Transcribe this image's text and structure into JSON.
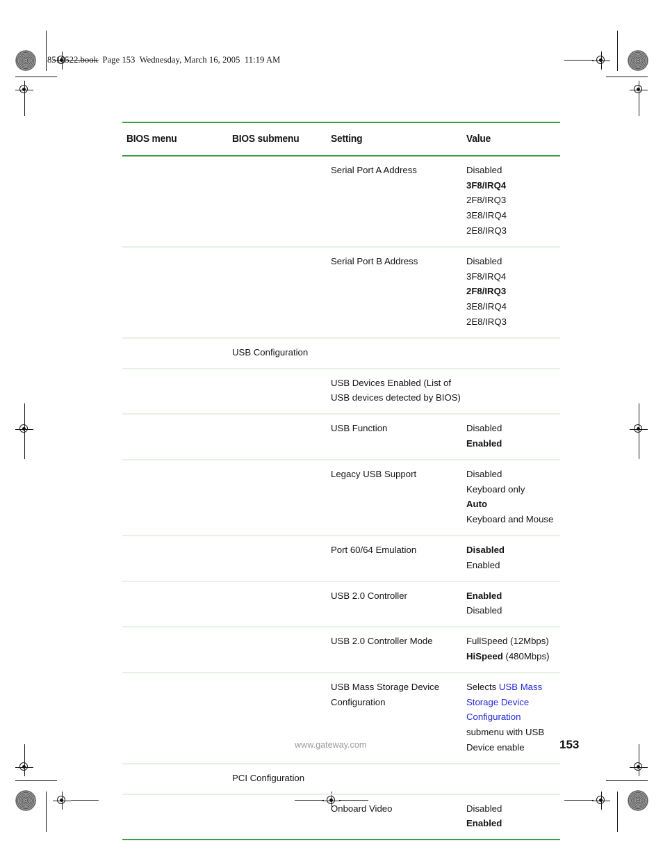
{
  "page": {
    "slug": "8510522.book  Page 153  Wednesday, March 16, 2005  11:19 AM",
    "footer_url": "www.gateway.com",
    "footer_page": "153",
    "rule_color": "#3d9b42",
    "separator_color": "#e4f1e4",
    "link_color": "#2327d8"
  },
  "table": {
    "headers": {
      "menu": "BIOS menu",
      "submenu": "BIOS submenu",
      "setting": "Setting",
      "value": "Value"
    },
    "rows": [
      {
        "menu": [],
        "submenu": [],
        "setting": [
          {
            "text": "Serial Port A Address",
            "bold": false
          }
        ],
        "value": [
          {
            "text": "Disabled",
            "bold": false
          },
          {
            "text": "3F8/IRQ4",
            "bold": true
          },
          {
            "text": "2F8/IRQ3",
            "bold": false
          },
          {
            "text": "3E8/IRQ4",
            "bold": false
          },
          {
            "text": "2E8/IRQ3",
            "bold": false
          }
        ]
      },
      {
        "menu": [],
        "submenu": [],
        "setting": [
          {
            "text": "Serial Port B Address",
            "bold": false
          }
        ],
        "value": [
          {
            "text": "Disabled",
            "bold": false
          },
          {
            "text": "3F8/IRQ4",
            "bold": false
          },
          {
            "text": "2F8/IRQ3",
            "bold": true
          },
          {
            "text": "3E8/IRQ4",
            "bold": false
          },
          {
            "text": "2E8/IRQ3",
            "bold": false
          }
        ]
      },
      {
        "menu": [],
        "submenu": [
          {
            "text": "USB Configuration",
            "bold": false
          }
        ],
        "setting": [],
        "value": []
      },
      {
        "menu": [],
        "submenu": [],
        "setting": [
          {
            "text": "USB Devices Enabled (List of USB devices detected by BIOS)",
            "bold": false
          }
        ],
        "value": []
      },
      {
        "menu": [],
        "submenu": [],
        "setting": [
          {
            "text": "USB Function",
            "bold": false
          }
        ],
        "value": [
          {
            "text": "Disabled",
            "bold": false
          },
          {
            "text": "Enabled",
            "bold": true
          }
        ]
      },
      {
        "menu": [],
        "submenu": [],
        "setting": [
          {
            "text": "Legacy USB Support",
            "bold": false
          }
        ],
        "value": [
          {
            "text": "Disabled",
            "bold": false
          },
          {
            "text": "Keyboard only",
            "bold": false
          },
          {
            "text": "Auto",
            "bold": true
          },
          {
            "text": "Keyboard and Mouse",
            "bold": false
          }
        ]
      },
      {
        "menu": [],
        "submenu": [],
        "setting": [
          {
            "text": "Port 60/64 Emulation",
            "bold": false
          }
        ],
        "value": [
          {
            "text": "Disabled",
            "bold": true
          },
          {
            "text": "Enabled",
            "bold": false
          }
        ]
      },
      {
        "menu": [],
        "submenu": [],
        "setting": [
          {
            "text": "USB 2.0 Controller",
            "bold": false
          }
        ],
        "value": [
          {
            "text": "Enabled",
            "bold": true
          },
          {
            "text": "Disabled",
            "bold": false
          }
        ]
      },
      {
        "menu": [],
        "submenu": [],
        "setting": [
          {
            "text": "USB 2.0 Controller Mode",
            "bold": false
          }
        ],
        "value": [
          {
            "parts": [
              {
                "text": "FullSpeed (12Mbps)",
                "bold": false
              }
            ]
          },
          {
            "parts": [
              {
                "text": "HiSpeed",
                "bold": true
              },
              {
                "text": " (480Mbps)",
                "bold": false
              }
            ]
          }
        ]
      },
      {
        "menu": [],
        "submenu": [],
        "setting": [
          {
            "text": "USB Mass Storage Device Configuration",
            "bold": false
          }
        ],
        "value": [
          {
            "parts": [
              {
                "text": "Selects ",
                "bold": false
              },
              {
                "text": "USB Mass Storage Device Configuration",
                "bold": false,
                "link": true
              },
              {
                "text": " submenu with USB Device enable",
                "bold": false
              }
            ]
          }
        ]
      },
      {
        "menu": [],
        "submenu": [
          {
            "text": "PCI Configuration",
            "bold": false
          }
        ],
        "setting": [],
        "value": []
      },
      {
        "menu": [],
        "submenu": [],
        "setting": [
          {
            "text": "Onboard Video",
            "bold": false
          }
        ],
        "value": [
          {
            "text": "Disabled",
            "bold": false
          },
          {
            "text": "Enabled",
            "bold": true
          }
        ]
      }
    ]
  }
}
